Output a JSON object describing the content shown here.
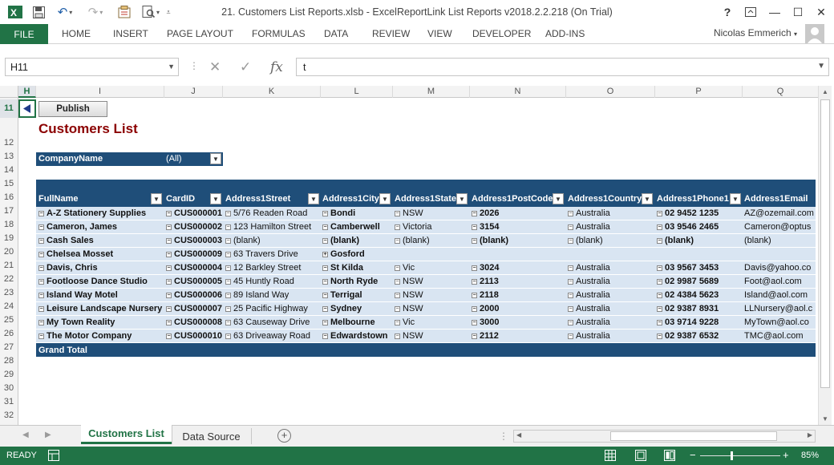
{
  "window": {
    "title": "21. Customers List Reports.xlsb - ExcelReportLink List Reports v2018.2.2.218 (On Trial)",
    "help": "?",
    "minimize": "—",
    "maximize": "☐",
    "close": "✕"
  },
  "ribbon": {
    "file": "FILE",
    "tabs": [
      "HOME",
      "INSERT",
      "PAGE LAYOUT",
      "FORMULAS",
      "DATA",
      "REVIEW",
      "VIEW",
      "DEVELOPER",
      "ADD-INS"
    ],
    "user": "Nicolas Emmerich"
  },
  "formula_bar": {
    "namebox": "H11",
    "fx": "fx",
    "value": "t"
  },
  "columns": [
    "H",
    "I",
    "J",
    "K",
    "L",
    "M",
    "N",
    "O",
    "P",
    "Q"
  ],
  "rows": [
    "11",
    "12",
    "13",
    "14",
    "15",
    "16",
    "17",
    "18",
    "19",
    "20",
    "21",
    "22",
    "23",
    "24",
    "25",
    "26",
    "27",
    "28",
    "29",
    "30",
    "31",
    "32",
    "33"
  ],
  "sheet": {
    "publish_button": "Publish",
    "title": "Customers List",
    "filter_label": "CompanyName",
    "filter_value": "(All)"
  },
  "pivot": {
    "headers": [
      "FullName",
      "CardID",
      "Address1Street",
      "Address1City",
      "Address1State",
      "Address1PostCode",
      "Address1Country",
      "Address1Phone1",
      "Address1Email"
    ],
    "rows": [
      [
        "A-Z Stationery Supplies",
        "CUS000001",
        "5/76 Readen Road",
        "Bondi",
        "NSW",
        "2026",
        "Australia",
        "02 9452 1235",
        "AZ@ozemail.com"
      ],
      [
        "Cameron, James",
        "CUS000002",
        "123 Hamilton Street",
        "Camberwell",
        "Victoria",
        "3154",
        "Australia",
        "03 9546 2465",
        "Cameron@optus"
      ],
      [
        "Cash Sales",
        "CUS000003",
        "(blank)",
        "(blank)",
        "(blank)",
        "(blank)",
        "(blank)",
        "(blank)",
        "(blank)"
      ],
      [
        "Chelsea Mosset",
        "CUS000009",
        "63 Travers Drive",
        "Gosford",
        "",
        "",
        "",
        "",
        ""
      ],
      [
        "Davis, Chris",
        "CUS000004",
        "12 Barkley Street",
        "St Kilda",
        "Vic",
        "3024",
        "Australia",
        "03 9567 3453",
        "Davis@yahoo.co"
      ],
      [
        "Footloose Dance Studio",
        "CUS000005",
        "45 Huntly Road",
        "North Ryde",
        "NSW",
        "2113",
        "Australia",
        "02 9987 5689",
        "Foot@aol.com"
      ],
      [
        "Island Way Motel",
        "CUS000006",
        "89 Island Way",
        "Terrigal",
        "NSW",
        "2118",
        "Australia",
        "02 4384 5623",
        "Island@aol.com"
      ],
      [
        "Leisure Landscape Nursery",
        "CUS000007",
        "25 Pacific Highway",
        "Sydney",
        "NSW",
        "2000",
        "Australia",
        "02 9387 8931",
        "LLNursery@aol.c"
      ],
      [
        "My Town Reality",
        "CUS000008",
        "63 Causeway Drive",
        "Melbourne",
        "Vic",
        "3000",
        "Australia",
        "03 9714 9228",
        "MyTown@aol.co"
      ],
      [
        "The Motor Company",
        "CUS000010",
        "63 Driveaway Road",
        "Edwardstown",
        "NSW",
        "2112",
        "Australia",
        "02 9387 6532",
        "TMC@aol.com"
      ]
    ],
    "grand_total": "Grand Total"
  },
  "tabs": {
    "active": "Customers List",
    "other": "Data Source",
    "add": "+"
  },
  "status": {
    "ready": "READY",
    "zoom": "85%",
    "zoom_minus": "−",
    "zoom_plus": "+"
  }
}
